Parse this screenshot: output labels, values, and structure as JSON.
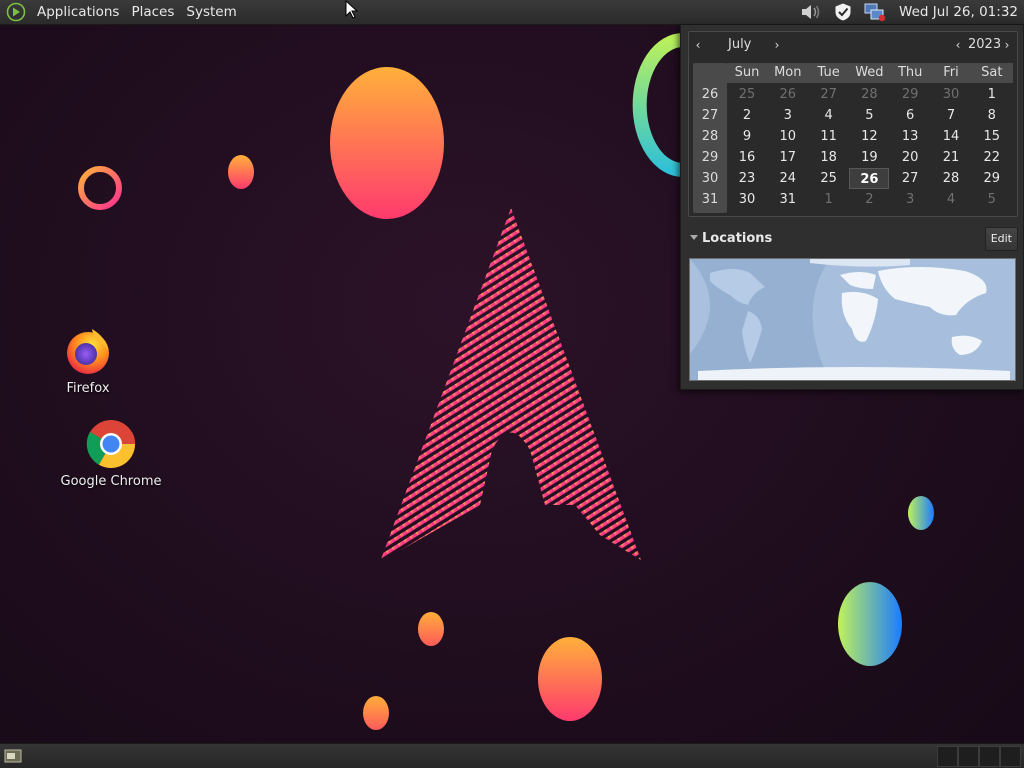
{
  "top_panel": {
    "menus": [
      "Applications",
      "Places",
      "System"
    ],
    "tray_icons": [
      "volume-icon",
      "shield-icon",
      "network-icon"
    ],
    "clock": "Wed Jul 26, 01:32"
  },
  "desktop": {
    "icons": [
      {
        "label": "Firefox",
        "icon": "firefox-icon"
      },
      {
        "label": "Google Chrome",
        "icon": "chrome-icon"
      }
    ]
  },
  "calendar": {
    "month": "July",
    "year": "2023",
    "prev_month": "‹",
    "next_month": "›",
    "prev_year": "‹",
    "next_year": "›",
    "weekdays": [
      "Sun",
      "Mon",
      "Tue",
      "Wed",
      "Thu",
      "Fri",
      "Sat"
    ],
    "weeks": [
      {
        "num": "26",
        "days": [
          [
            "25",
            true
          ],
          [
            "26",
            true
          ],
          [
            "27",
            true
          ],
          [
            "28",
            true
          ],
          [
            "29",
            true
          ],
          [
            "30",
            true
          ],
          [
            "1",
            false
          ]
        ]
      },
      {
        "num": "27",
        "days": [
          [
            "2",
            false
          ],
          [
            "3",
            false
          ],
          [
            "4",
            false
          ],
          [
            "5",
            false
          ],
          [
            "6",
            false
          ],
          [
            "7",
            false
          ],
          [
            "8",
            false
          ]
        ]
      },
      {
        "num": "28",
        "days": [
          [
            "9",
            false
          ],
          [
            "10",
            false
          ],
          [
            "11",
            false
          ],
          [
            "12",
            false
          ],
          [
            "13",
            false
          ],
          [
            "14",
            false
          ],
          [
            "15",
            false
          ]
        ]
      },
      {
        "num": "29",
        "days": [
          [
            "16",
            false
          ],
          [
            "17",
            false
          ],
          [
            "18",
            false
          ],
          [
            "19",
            false
          ],
          [
            "20",
            false
          ],
          [
            "21",
            false
          ],
          [
            "22",
            false
          ]
        ]
      },
      {
        "num": "30",
        "days": [
          [
            "23",
            false
          ],
          [
            "24",
            false
          ],
          [
            "25",
            false
          ],
          [
            "26",
            false
          ],
          [
            "27",
            false
          ],
          [
            "28",
            false
          ],
          [
            "29",
            false
          ]
        ]
      },
      {
        "num": "31",
        "days": [
          [
            "30",
            false
          ],
          [
            "31",
            false
          ],
          [
            "1",
            true
          ],
          [
            "2",
            true
          ],
          [
            "3",
            true
          ],
          [
            "4",
            true
          ],
          [
            "5",
            true
          ]
        ]
      }
    ],
    "today": "26",
    "locations_label": "Locations",
    "edit_label": "Edit"
  },
  "colors": {
    "accent_pink": "#ff2f8e",
    "accent_orange": "#ffa63a",
    "accent_blue": "#1e86ff",
    "accent_green": "#b6f25a"
  }
}
